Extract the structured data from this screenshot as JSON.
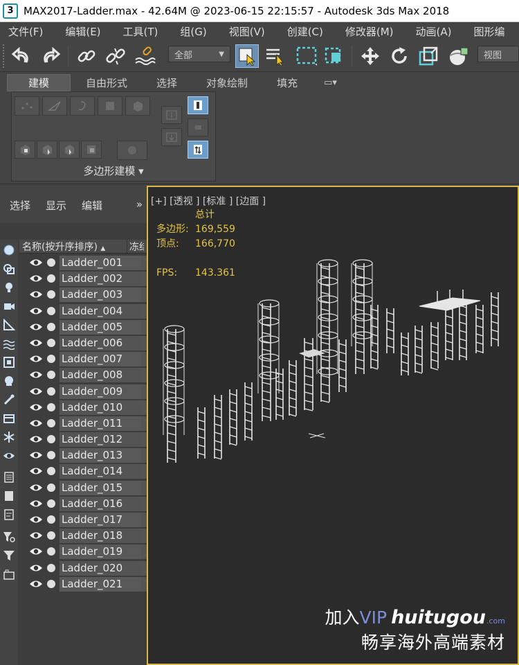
{
  "window": {
    "title": "MAX2017-Ladder.max - 42.64M @ 2023-06-15 22:15:57 - Autodesk 3ds Max 2018",
    "app_icon_label": "3"
  },
  "menubar": {
    "items": [
      "文件(F)",
      "编辑(E)",
      "工具(T)",
      "组(G)",
      "视图(V)",
      "创建(C)",
      "修改器(M)",
      "动画(A)",
      "图形编"
    ]
  },
  "toolbar": {
    "selection_filter": "全部",
    "view_coord": "视图",
    "icons": [
      "undo-icon",
      "redo-icon",
      "link-icon",
      "unlink-icon",
      "bind-spacewarp-icon",
      "select-object-icon",
      "select-by-name-icon",
      "rect-select-region-icon",
      "window-crossing-icon",
      "move-icon",
      "rotate-icon",
      "scale-icon",
      "view-icon"
    ]
  },
  "ribbon": {
    "tabs": [
      "建模",
      "自由形式",
      "选择",
      "对象绘制",
      "填充"
    ],
    "active_tab": "建模",
    "panel_label": "多边形建模 ▾"
  },
  "explorer": {
    "menu": [
      "选择",
      "显示",
      "编辑"
    ],
    "column_name": "名称(按升序排序)",
    "sort_indicator": "▲",
    "column_frozen": "冻结",
    "items": [
      "Ladder_001",
      "Ladder_002",
      "Ladder_003",
      "Ladder_004",
      "Ladder_005",
      "Ladder_006",
      "Ladder_007",
      "Ladder_008",
      "Ladder_009",
      "Ladder_010",
      "Ladder_011",
      "Ladder_012",
      "Ladder_013",
      "Ladder_014",
      "Ladder_015",
      "Ladder_016",
      "Ladder_017",
      "Ladder_018",
      "Ladder_019",
      "Ladder_020",
      "Ladder_021"
    ]
  },
  "viewport": {
    "label": "[+] [透视 ] [标准 ] [边面 ]",
    "stats": {
      "header": "总计",
      "polys_label": "多边形:",
      "polys_value": "169,559",
      "verts_label": "顶点:",
      "verts_value": "166,770",
      "fps_label": "FPS:",
      "fps_value": "143.361"
    }
  },
  "watermark": {
    "line1_a": "加入",
    "line1_vip": "VIP",
    "line1_brand": "huitugou",
    "line1_com": ".com",
    "line2": "畅享海外高端素材"
  },
  "colors": {
    "viewport_border": "#d8b84a",
    "stats_text": "#e4c447",
    "accent_blue": "#6d9dc9"
  }
}
